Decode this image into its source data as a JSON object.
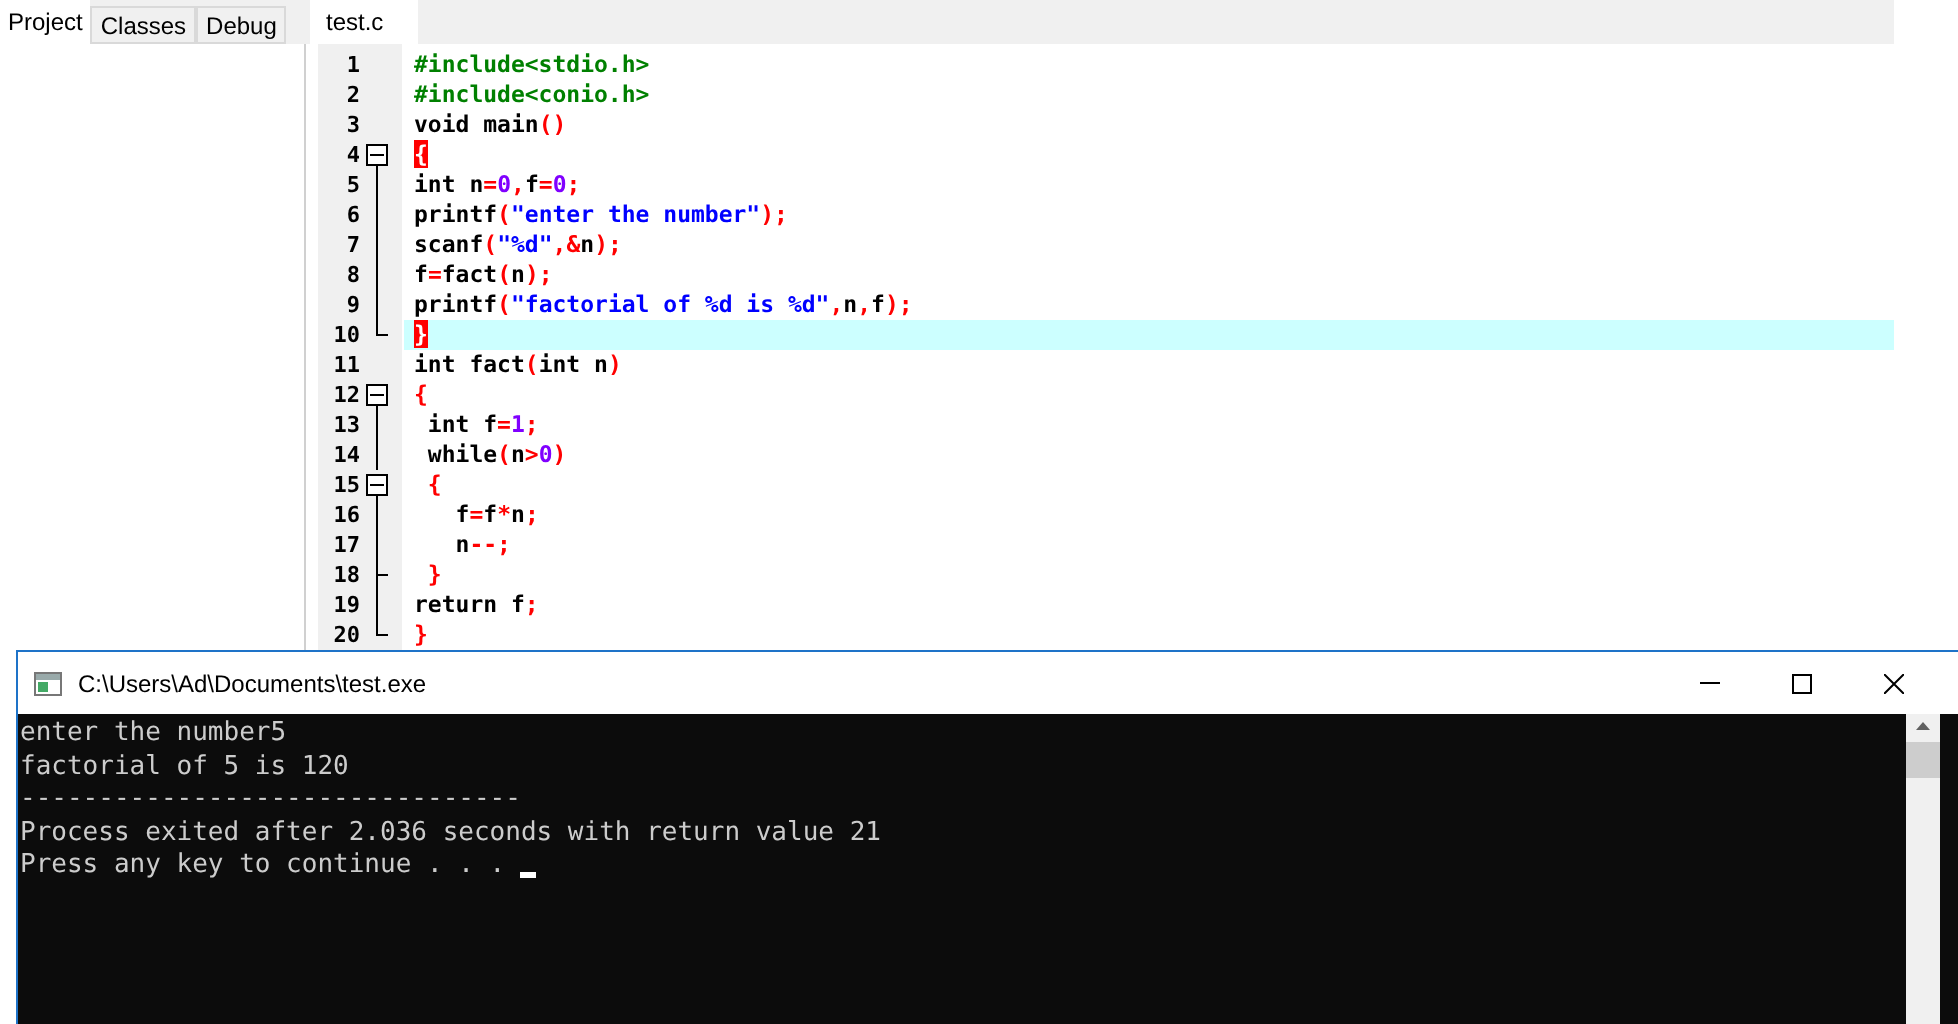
{
  "left_panel": {
    "tabs": [
      {
        "label": "Project",
        "selected": true
      },
      {
        "label": "Classes",
        "selected": false
      },
      {
        "label": "Debug",
        "selected": false
      }
    ]
  },
  "editor": {
    "tabs": [
      {
        "label": "test.c",
        "selected": true
      }
    ],
    "lines": [
      {
        "number": "1",
        "tokens": [
          {
            "text": "#include<stdio.h>",
            "kind": "pre"
          }
        ]
      },
      {
        "number": "2",
        "tokens": [
          {
            "text": "#include<conio.h>",
            "kind": "pre"
          }
        ]
      },
      {
        "number": "3",
        "tokens": [
          {
            "text": "void main",
            "kind": "id"
          },
          {
            "text": "()",
            "kind": "sym"
          }
        ]
      },
      {
        "number": "4",
        "kind": "start",
        "tokens": [
          {
            "text": "{",
            "kind": "match"
          }
        ]
      },
      {
        "number": "5",
        "kind": "inside",
        "tokens": [
          {
            "text": "int n",
            "kind": "id"
          },
          {
            "text": "=",
            "kind": "sym"
          },
          {
            "text": "0",
            "kind": "num"
          },
          {
            "text": ",",
            "kind": "sym"
          },
          {
            "text": "f",
            "kind": "id"
          },
          {
            "text": "=",
            "kind": "sym"
          },
          {
            "text": "0",
            "kind": "num"
          },
          {
            "text": ";",
            "kind": "sym"
          }
        ]
      },
      {
        "number": "6",
        "kind": "inside",
        "tokens": [
          {
            "text": "printf",
            "kind": "id"
          },
          {
            "text": "(",
            "kind": "sym"
          },
          {
            "text": "\"enter the number\"",
            "kind": "str"
          },
          {
            "text": ");",
            "kind": "sym"
          }
        ]
      },
      {
        "number": "7",
        "kind": "inside",
        "tokens": [
          {
            "text": "scanf",
            "kind": "id"
          },
          {
            "text": "(",
            "kind": "sym"
          },
          {
            "text": "\"%d\"",
            "kind": "str"
          },
          {
            "text": ",&",
            "kind": "sym"
          },
          {
            "text": "n",
            "kind": "id"
          },
          {
            "text": ");",
            "kind": "sym"
          }
        ]
      },
      {
        "number": "8",
        "kind": "inside",
        "tokens": [
          {
            "text": "f",
            "kind": "id"
          },
          {
            "text": "=",
            "kind": "sym"
          },
          {
            "text": "fact",
            "kind": "id"
          },
          {
            "text": "(",
            "kind": "sym"
          },
          {
            "text": "n",
            "kind": "id"
          },
          {
            "text": ");",
            "kind": "sym"
          }
        ]
      },
      {
        "number": "9",
        "kind": "inside",
        "tokens": [
          {
            "text": "printf",
            "kind": "id"
          },
          {
            "text": "(",
            "kind": "sym"
          },
          {
            "text": "\"factorial of %d is %d\"",
            "kind": "str"
          },
          {
            "text": ",",
            "kind": "sym"
          },
          {
            "text": "n",
            "kind": "id"
          },
          {
            "text": ",",
            "kind": "sym"
          },
          {
            "text": "f",
            "kind": "id"
          },
          {
            "text": ");",
            "kind": "sym"
          }
        ]
      },
      {
        "number": "10",
        "kind": "end",
        "current": true,
        "tokens": [
          {
            "text": "}",
            "kind": "match"
          }
        ]
      },
      {
        "number": "11",
        "tokens": [
          {
            "text": "int fact",
            "kind": "id"
          },
          {
            "text": "(",
            "kind": "sym"
          },
          {
            "text": "int n",
            "kind": "id"
          },
          {
            "text": ")",
            "kind": "sym"
          }
        ]
      },
      {
        "number": "12",
        "kind": "start",
        "tokens": [
          {
            "text": "{",
            "kind": "sym"
          }
        ]
      },
      {
        "number": "13",
        "kind": "inside",
        "tokens": [
          {
            "text": " int f",
            "kind": "id"
          },
          {
            "text": "=",
            "kind": "sym"
          },
          {
            "text": "1",
            "kind": "num"
          },
          {
            "text": ";",
            "kind": "sym"
          }
        ]
      },
      {
        "number": "14",
        "kind": "inside",
        "tokens": [
          {
            "text": " while",
            "kind": "id"
          },
          {
            "text": "(",
            "kind": "sym"
          },
          {
            "text": "n",
            "kind": "id"
          },
          {
            "text": ">",
            "kind": "sym"
          },
          {
            "text": "0",
            "kind": "num"
          },
          {
            "text": ")",
            "kind": "sym"
          }
        ]
      },
      {
        "number": "15",
        "kind": "start",
        "tokens": [
          {
            "text": " {",
            "kind": "sym"
          }
        ]
      },
      {
        "number": "16",
        "kind": "inside",
        "tokens": [
          {
            "text": "   f",
            "kind": "id"
          },
          {
            "text": "=",
            "kind": "sym"
          },
          {
            "text": "f",
            "kind": "id"
          },
          {
            "text": "*",
            "kind": "sym"
          },
          {
            "text": "n",
            "kind": "id"
          },
          {
            "text": ";",
            "kind": "sym"
          }
        ]
      },
      {
        "number": "17",
        "kind": "inside",
        "tokens": [
          {
            "text": "   n",
            "kind": "id"
          },
          {
            "text": "--;",
            "kind": "sym"
          }
        ]
      },
      {
        "number": "18",
        "kind": "branch",
        "tokens": [
          {
            "text": " }",
            "kind": "sym"
          }
        ]
      },
      {
        "number": "19",
        "kind": "inside",
        "tokens": [
          {
            "text": "return f",
            "kind": "id"
          },
          {
            "text": ";",
            "kind": "sym"
          }
        ]
      },
      {
        "number": "20",
        "kind": "end",
        "tokens": [
          {
            "text": "}",
            "kind": "sym"
          }
        ]
      }
    ]
  },
  "console": {
    "title": "C:\\Users\\Ad\\Documents\\test.exe",
    "lines": [
      "enter the number5",
      "factorial of 5 is 120",
      "--------------------------------",
      "Process exited after 2.036 seconds with return value 21",
      "Press any key to continue . . . "
    ]
  }
}
